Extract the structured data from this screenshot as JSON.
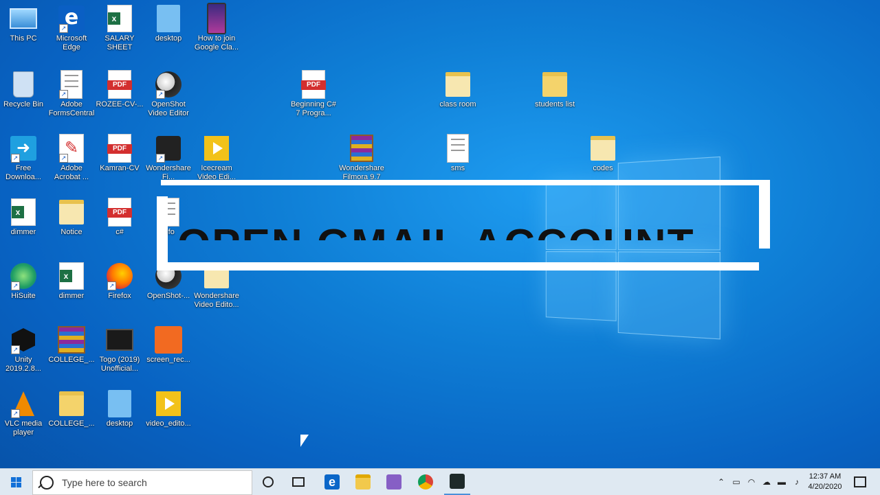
{
  "desktop": {
    "icons": [
      {
        "label": "This PC"
      },
      {
        "label": "Microsoft Edge"
      },
      {
        "label": "SALARY SHEET"
      },
      {
        "label": "desktop"
      },
      {
        "label": "How to join Google Cla..."
      },
      {
        "label": "Recycle Bin"
      },
      {
        "label": "Adobe FormsCentral"
      },
      {
        "label": "ROZEE-CV-..."
      },
      {
        "label": "OpenShot Video Editor"
      },
      {
        "label": "Beginning C# 7 Progra..."
      },
      {
        "label": "class room"
      },
      {
        "label": "students list"
      },
      {
        "label": "Free Downloa..."
      },
      {
        "label": "Adobe Acrobat ..."
      },
      {
        "label": "Kamran-CV"
      },
      {
        "label": "Wondershare Fi..."
      },
      {
        "label": "Icecream Video Edi..."
      },
      {
        "label": "Wondershare Filmora 9.7"
      },
      {
        "label": "sms"
      },
      {
        "label": "codes"
      },
      {
        "label": "dimmer"
      },
      {
        "label": "Notice"
      },
      {
        "label": "c#"
      },
      {
        "label": "info"
      },
      {
        "label": "HiSuite"
      },
      {
        "label": "dimmer"
      },
      {
        "label": "Firefox"
      },
      {
        "label": "OpenShot-..."
      },
      {
        "label": "Wondershare Video Edito..."
      },
      {
        "label": "Unity 2019.2.8..."
      },
      {
        "label": "COLLEGE_..."
      },
      {
        "label": "Togo (2019) Unofficial..."
      },
      {
        "label": "screen_rec..."
      },
      {
        "label": "VLC media player"
      },
      {
        "label": "COLLEGE_..."
      },
      {
        "label": "desktop"
      },
      {
        "label": "video_edito..."
      }
    ]
  },
  "overlay": {
    "text": "OPEN GMAIL ACCOUNT"
  },
  "taskbar": {
    "search_placeholder": "Type here to search",
    "time": "12:37 AM",
    "date": "4/20/2020"
  },
  "colors": {
    "desktop_bg": "#0f7fd6",
    "taskbar_bg": "#dfe9f2",
    "start_blue": "#1270d8"
  }
}
